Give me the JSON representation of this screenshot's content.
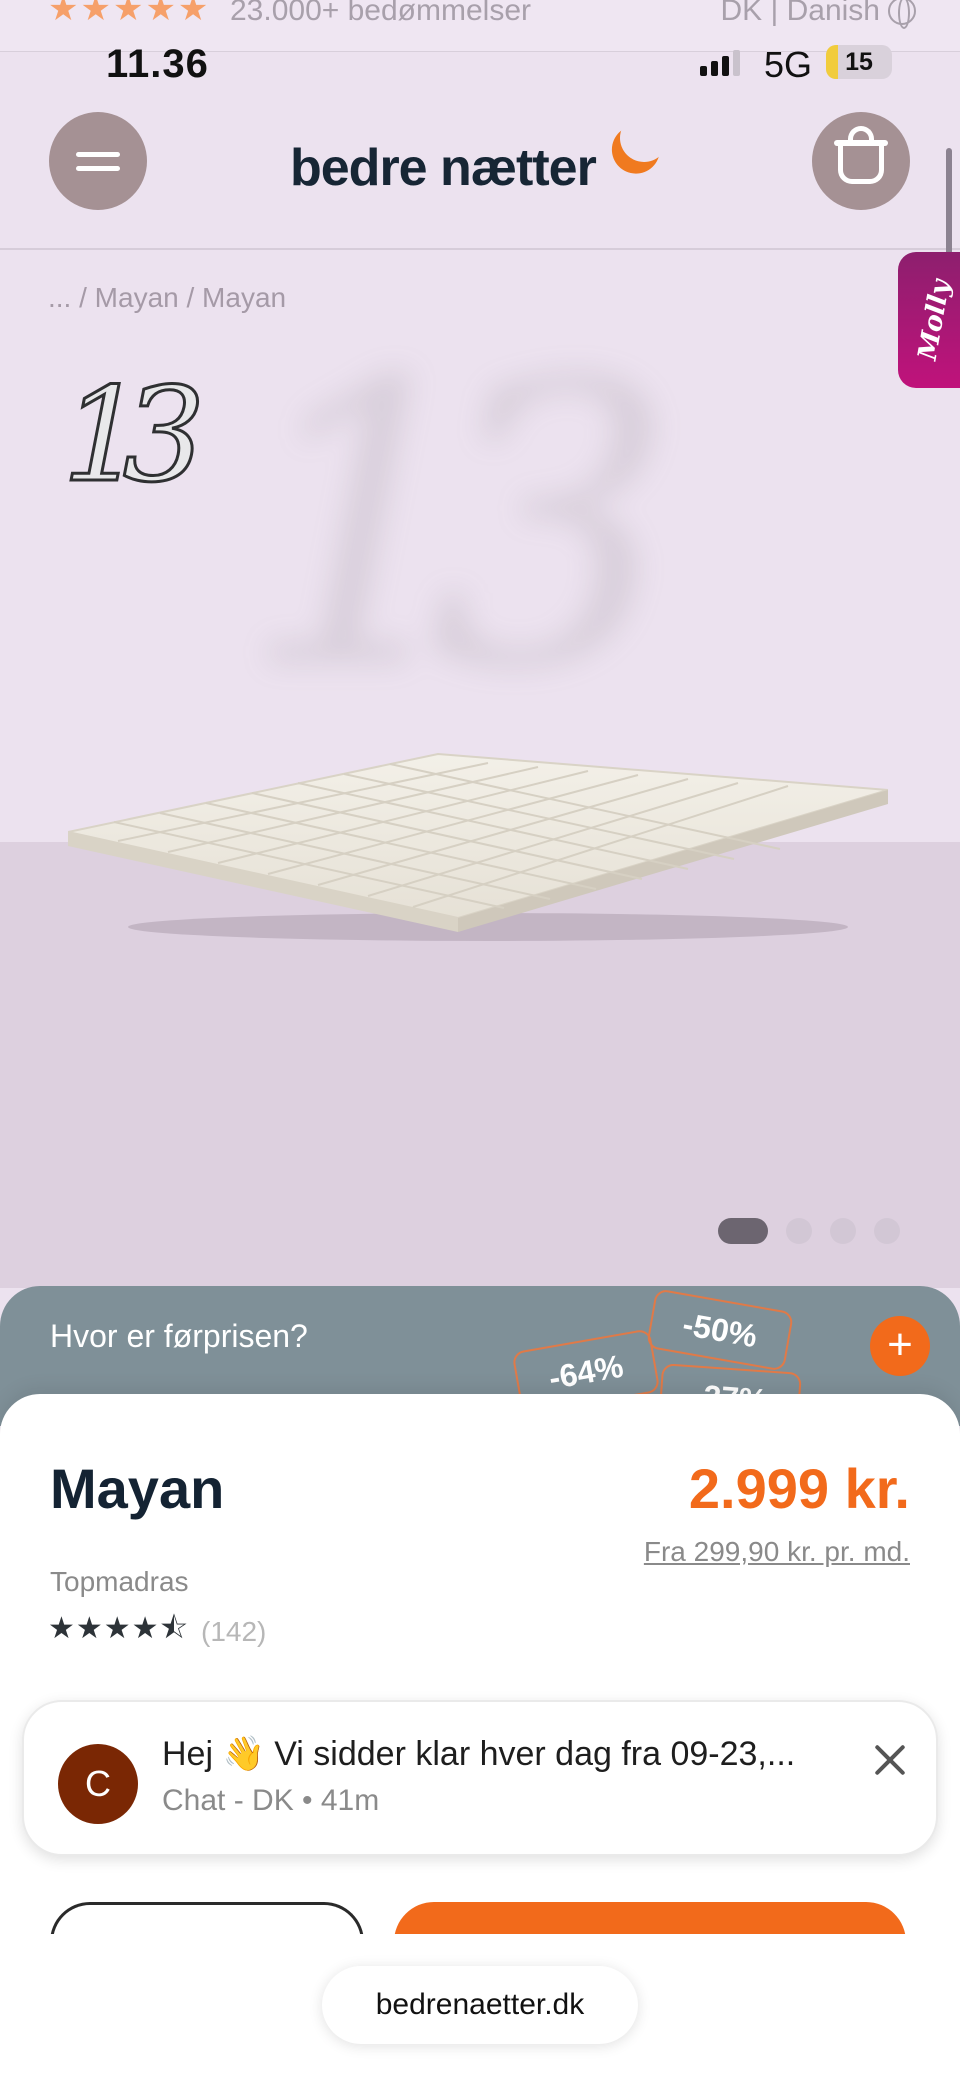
{
  "top_strip": {
    "stars": "★★★★★",
    "reviews": "23.000+ bedømmelser",
    "locale": "DK | Danish"
  },
  "status_bar": {
    "time": "11.36",
    "network": "5G",
    "battery": "15"
  },
  "header": {
    "logo": "bedre nætter"
  },
  "breadcrumb": "... / Mayan / Mayan",
  "hero": {
    "brand_mark": "13",
    "carousel": {
      "total": 4,
      "active": 1
    }
  },
  "side_tab": {
    "label": "Molly"
  },
  "price_hint": {
    "label": "Hvor er førprisen?",
    "tags": [
      "-64%",
      "-50%",
      "-27%"
    ],
    "plus": "+"
  },
  "product": {
    "name": "Mayan",
    "price": "2.999 kr.",
    "installment": "Fra 299,90 kr. pr. md.",
    "category": "Topmadras",
    "stars": "★★★★⯪",
    "rating_value": 4.5,
    "review_count": "(142)"
  },
  "chat": {
    "avatar_letter": "C",
    "message": "Hej 👋 Vi sidder klar hver dag fra 09-23,...",
    "meta": "Chat - DK • 41m"
  },
  "browser": {
    "url": "bedrenaetter.dk"
  },
  "colors": {
    "accent": "#f26a1b",
    "navy": "#142333",
    "hero_bg": "#ece2ef",
    "band": "#7f9098"
  }
}
